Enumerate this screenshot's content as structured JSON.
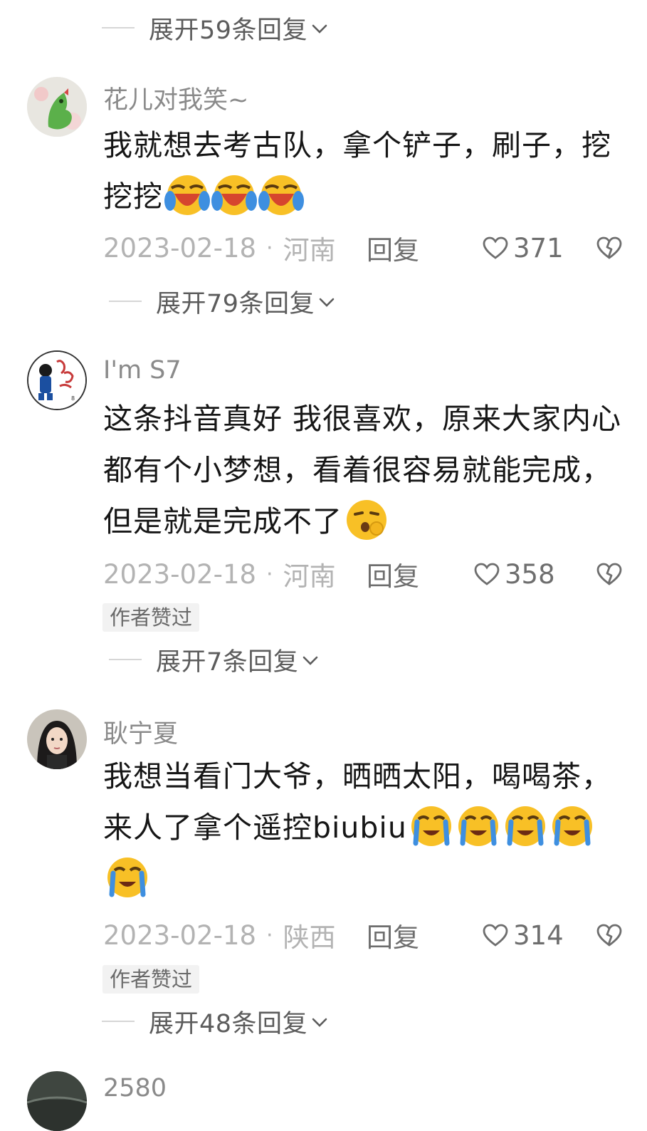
{
  "top_expand": {
    "label": "展开59条回复"
  },
  "comments": [
    {
      "username": "花儿对我笑~",
      "text": "我就想去考古队，拿个铲子，刷子，挖挖挖",
      "emoji": [
        "rofl-crying-emoji",
        "rofl-crying-emoji",
        "rofl-crying-emoji"
      ],
      "date": "2023-02-18",
      "separator": "·",
      "region": "河南",
      "reply_label": "回复",
      "likes": "371",
      "expand_label": "展开79条回复"
    },
    {
      "username": "I'm S7",
      "text": "这条抖音真好 我很喜欢，原来大家内心都有个小梦想，看着很容易就能完成，但是就是完成不了",
      "emoji": [
        "yawning-face-emoji"
      ],
      "date": "2023-02-18",
      "separator": "·",
      "region": "河南",
      "reply_label": "回复",
      "likes": "358",
      "badge": "作者赞过",
      "expand_label": "展开7条回复"
    },
    {
      "username": "耿宁夏",
      "text": "我想当看门大爷，晒晒太阳，喝喝茶，来人了拿个遥控biubiu",
      "emoji": [
        "loudly-crying-face-emoji",
        "loudly-crying-face-emoji",
        "loudly-crying-face-emoji",
        "loudly-crying-face-emoji",
        "loudly-crying-face-emoji"
      ],
      "date": "2023-02-18",
      "separator": "·",
      "region": "陕西",
      "reply_label": "回复",
      "likes": "314",
      "badge": "作者赞过",
      "expand_label": "展开48条回复"
    },
    {
      "username": "2580"
    }
  ],
  "colors": {
    "text": "#161616",
    "username": "#8a8a8a",
    "meta": "#b3b3b3",
    "action": "#6e6e6e",
    "badge_bg": "#f2f2f2"
  }
}
